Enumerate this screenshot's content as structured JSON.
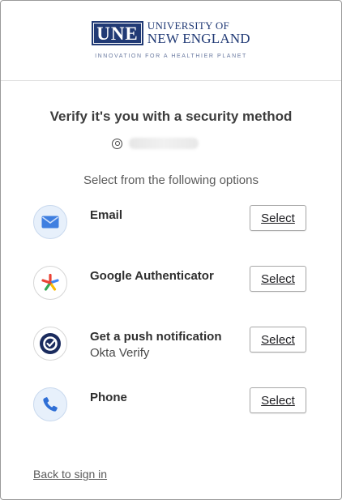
{
  "brand": {
    "mark": "UNE",
    "line1": "UNIVERSITY OF",
    "line2": "NEW ENGLAND",
    "tagline": "INNOVATION FOR A HEALTHIER PLANET",
    "color": "#213a75"
  },
  "page": {
    "title": "Verify it's you with a security method",
    "subtitle": "Select from the following options",
    "back_link": "Back to sign in"
  },
  "options": [
    {
      "name": "Email",
      "sub": "",
      "icon": "email-icon",
      "button": "Select"
    },
    {
      "name": "Google Authenticator",
      "sub": "",
      "icon": "google-authenticator-icon",
      "button": "Select"
    },
    {
      "name": "Get a push notification",
      "sub": "Okta Verify",
      "icon": "okta-verify-icon",
      "button": "Select"
    },
    {
      "name": "Phone",
      "sub": "",
      "icon": "phone-icon",
      "button": "Select"
    }
  ]
}
